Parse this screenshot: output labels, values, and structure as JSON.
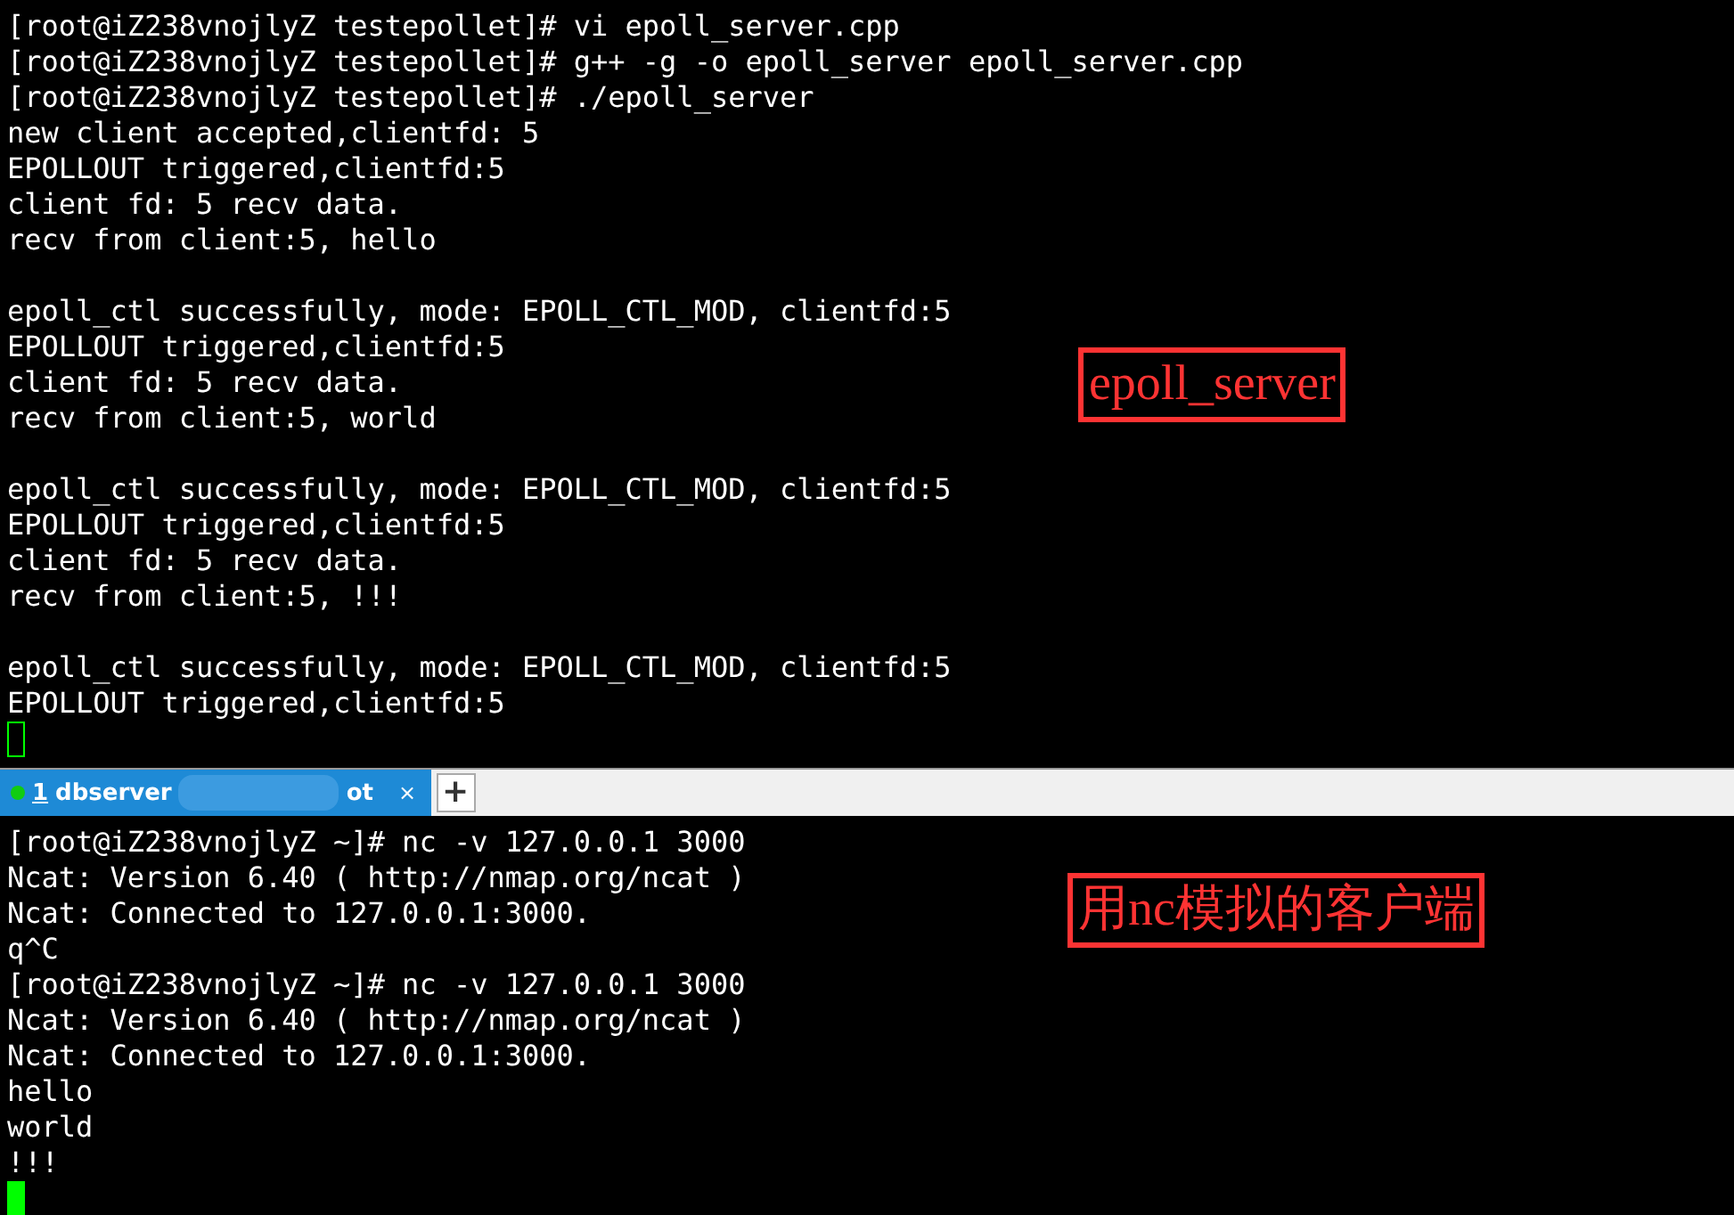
{
  "top_terminal": {
    "blocks": [
      [
        "[root@iZ238vnojlyZ testepollet]# vi epoll_server.cpp",
        "[root@iZ238vnojlyZ testepollet]# g++ -g -o epoll_server epoll_server.cpp",
        "[root@iZ238vnojlyZ testepollet]# ./epoll_server",
        "new client accepted,clientfd: 5",
        "EPOLLOUT triggered,clientfd:5",
        "client fd: 5 recv data.",
        "recv from client:5, hello"
      ],
      [
        "epoll_ctl successfully, mode: EPOLL_CTL_MOD, clientfd:5",
        "EPOLLOUT triggered,clientfd:5",
        "client fd: 5 recv data.",
        "recv from client:5, world"
      ],
      [
        "epoll_ctl successfully, mode: EPOLL_CTL_MOD, clientfd:5",
        "EPOLLOUT triggered,clientfd:5",
        "client fd: 5 recv data.",
        "recv from client:5, !!!"
      ],
      [
        "epoll_ctl successfully, mode: EPOLL_CTL_MOD, clientfd:5",
        "EPOLLOUT triggered,clientfd:5"
      ]
    ],
    "focused": false,
    "annotation": "epoll_server"
  },
  "tabs": [
    {
      "number": "1",
      "label": "dbserver",
      "label_end": "ot",
      "close": "×",
      "selected": true,
      "connected": true
    }
  ],
  "new_tab": "+",
  "bottom_terminal": {
    "blocks": [
      [
        "[root@iZ238vnojlyZ ~]# nc -v 127.0.0.1 3000",
        "Ncat: Version 6.40 ( http://nmap.org/ncat )",
        "Ncat: Connected to 127.0.0.1:3000.",
        "q^C",
        "[root@iZ238vnojlyZ ~]# nc -v 127.0.0.1 3000",
        "Ncat: Version 6.40 ( http://nmap.org/ncat )",
        "Ncat: Connected to 127.0.0.1:3000.",
        "hello",
        "world",
        "!!!"
      ]
    ],
    "focused": true,
    "annotation": "用nc模拟的客户端"
  }
}
